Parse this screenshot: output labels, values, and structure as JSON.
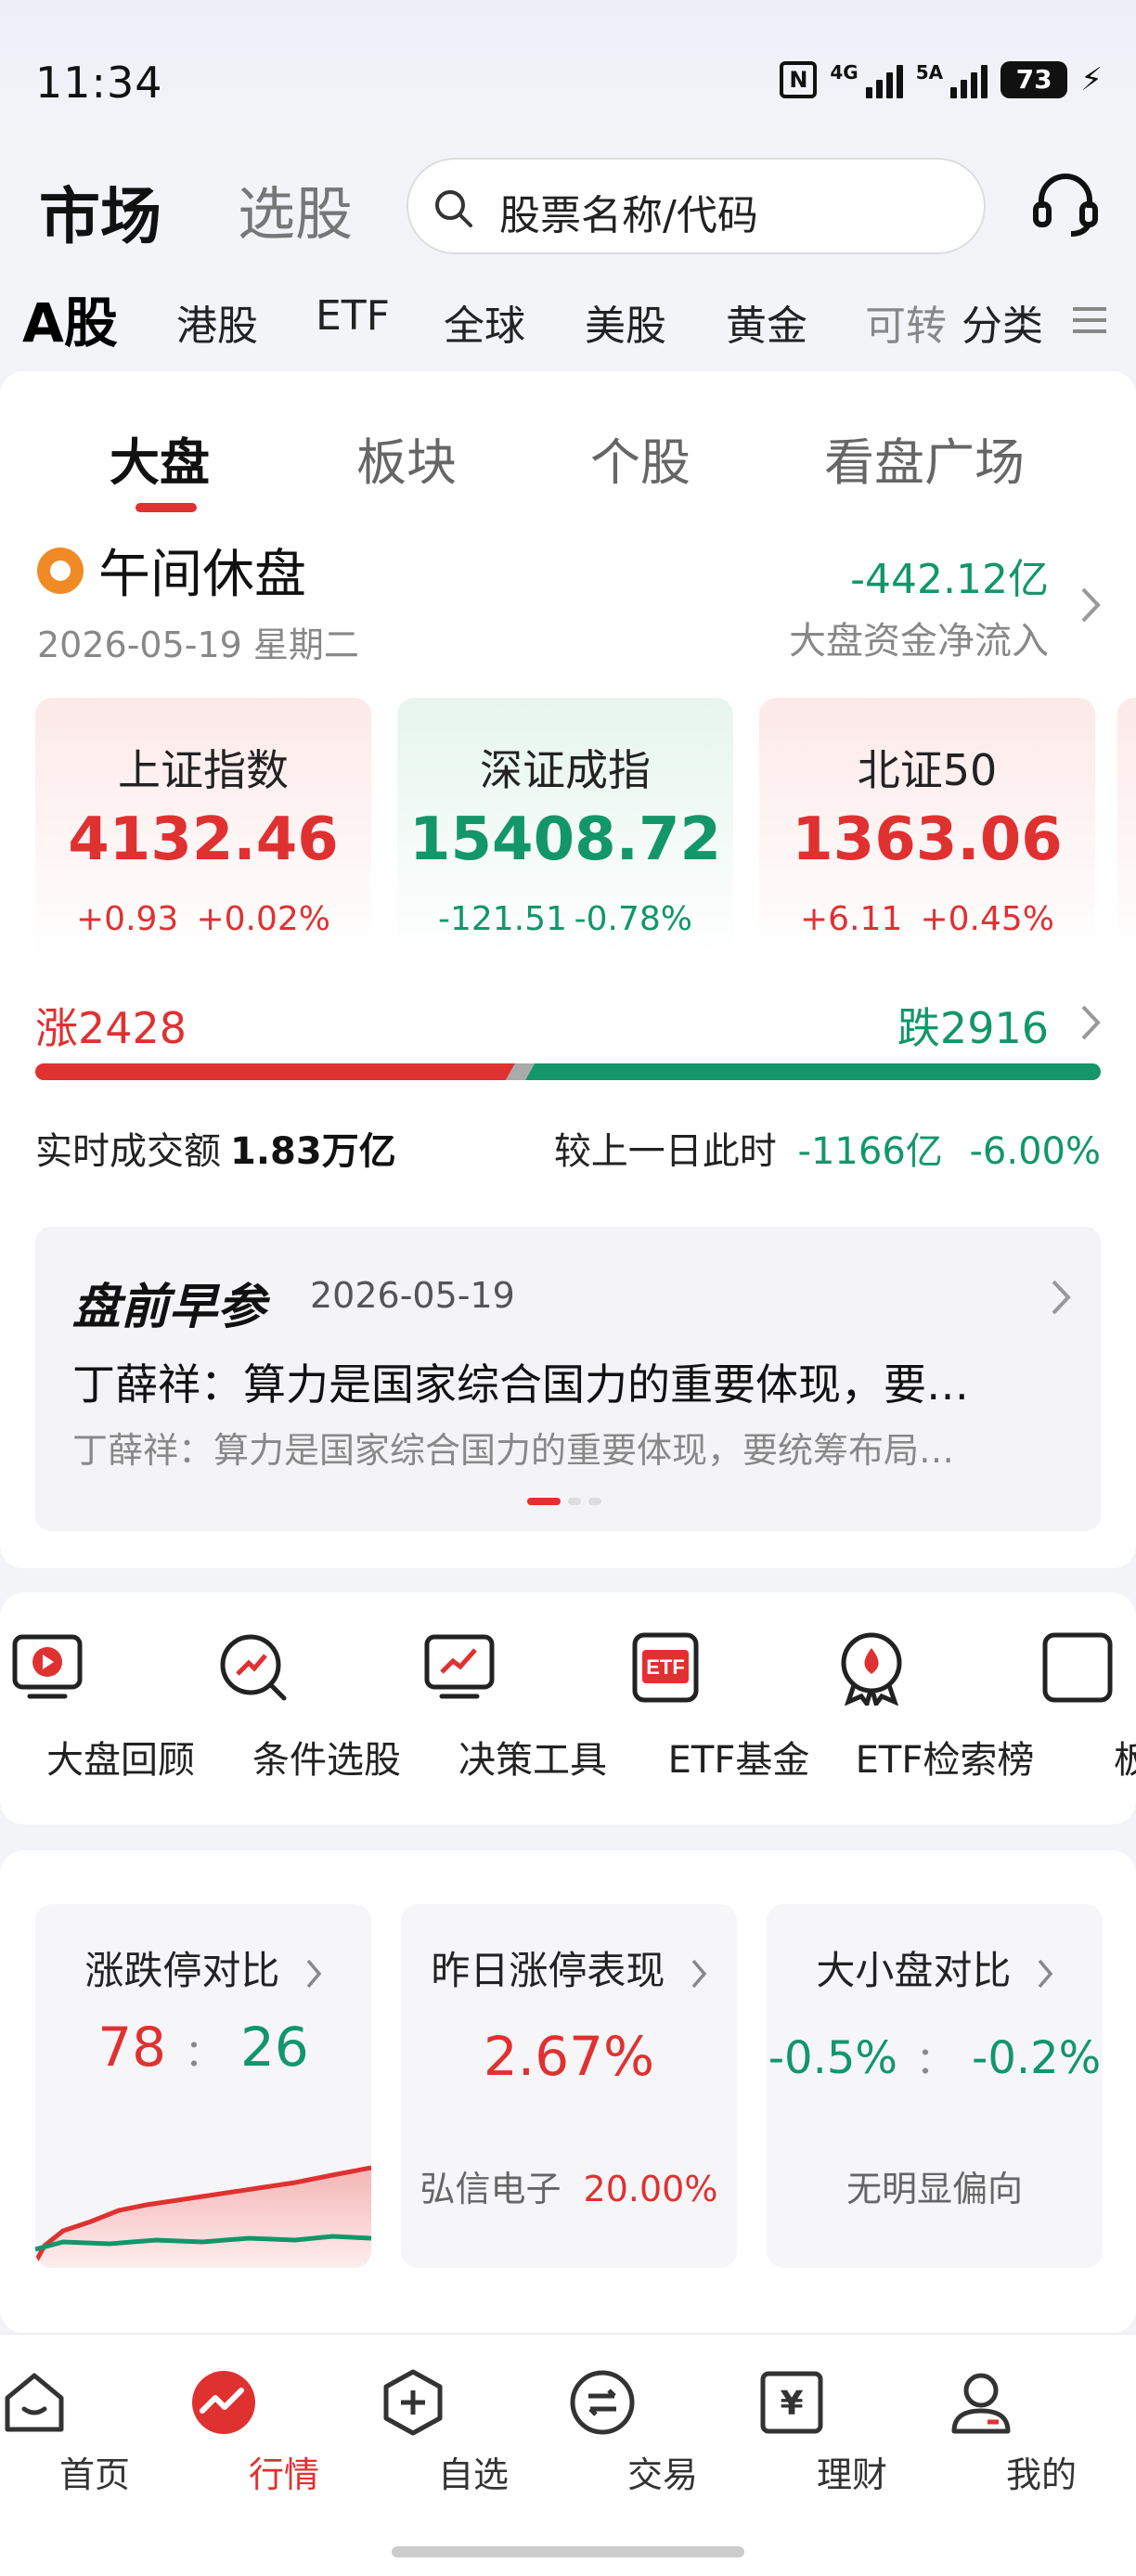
{
  "status_bar": {
    "time": "11:34",
    "nfc": "N",
    "signal1": "4G",
    "signal2": "5A",
    "battery": "73"
  },
  "header": {
    "tab_market": "市场",
    "tab_pick": "选股",
    "search_placeholder": "股票名称/代码"
  },
  "market_tabs": [
    "A股",
    "港股",
    "ETF",
    "全球",
    "美股",
    "黄金",
    "可转",
    "分类"
  ],
  "sub_tabs": [
    "大盘",
    "板块",
    "个股",
    "看盘广场"
  ],
  "session": {
    "title": "午间休盘",
    "date": "2026-05-19 星期二",
    "netflow_value": "-442.12亿",
    "netflow_label": "大盘资金净流入"
  },
  "indices": [
    {
      "name": "上证指数",
      "value": "4132.46",
      "change": "+0.93",
      "pct": "+0.02%",
      "trend": "up"
    },
    {
      "name": "深证成指",
      "value": "15408.72",
      "change": "-121.51",
      "pct": "-0.78%",
      "trend": "down"
    },
    {
      "name": "北证50",
      "value": "1363.06",
      "change": "+6.11",
      "pct": "+0.45%",
      "trend": "up"
    }
  ],
  "breadth": {
    "up_label": "涨",
    "up_count": "2428",
    "down_label": "跌",
    "down_count": "2916",
    "up_share": 0.45,
    "down_share": 0.54
  },
  "turnover": {
    "label": "实时成交额",
    "value": "1.83万亿",
    "compare_label": "较上一日此时",
    "compare_value": "-1166亿",
    "compare_pct": "-6.00%"
  },
  "news": {
    "title": "盘前早参",
    "date": "2026-05-19",
    "headline": "丁薛祥：算力是国家综合国力的重要体现，要…",
    "snippet": "丁薛祥：算力是国家综合国力的重要体现，要统筹布局…",
    "page_current": 1,
    "page_total": 3
  },
  "tools": [
    {
      "label": "大盘回顾",
      "icon": "video-play-icon"
    },
    {
      "label": "条件选股",
      "icon": "search-trend-icon"
    },
    {
      "label": "决策工具",
      "icon": "monitor-trend-icon"
    },
    {
      "label": "ETF基金",
      "icon": "etf-icon"
    },
    {
      "label": "ETF检索榜",
      "icon": "medal-icon"
    },
    {
      "label": "板块",
      "icon": "sector-icon"
    }
  ],
  "stats": {
    "limit": {
      "title": "涨跌停对比",
      "up": "78",
      "sep": "：",
      "down": "26"
    },
    "yesterday": {
      "title": "昨日涨停表现",
      "value": "2.67%",
      "stock": "弘信电子",
      "stock_pct": "20.00%"
    },
    "size": {
      "title": "大小盘对比",
      "large": "-0.5%",
      "sep": "：",
      "small": "-0.2%",
      "note": "无明显偏向"
    }
  },
  "bottom_nav": [
    "首页",
    "行情",
    "自选",
    "交易",
    "理财",
    "我的"
  ],
  "colors": {
    "up": "#e03131",
    "down": "#12966a",
    "accent": "#e03131"
  }
}
